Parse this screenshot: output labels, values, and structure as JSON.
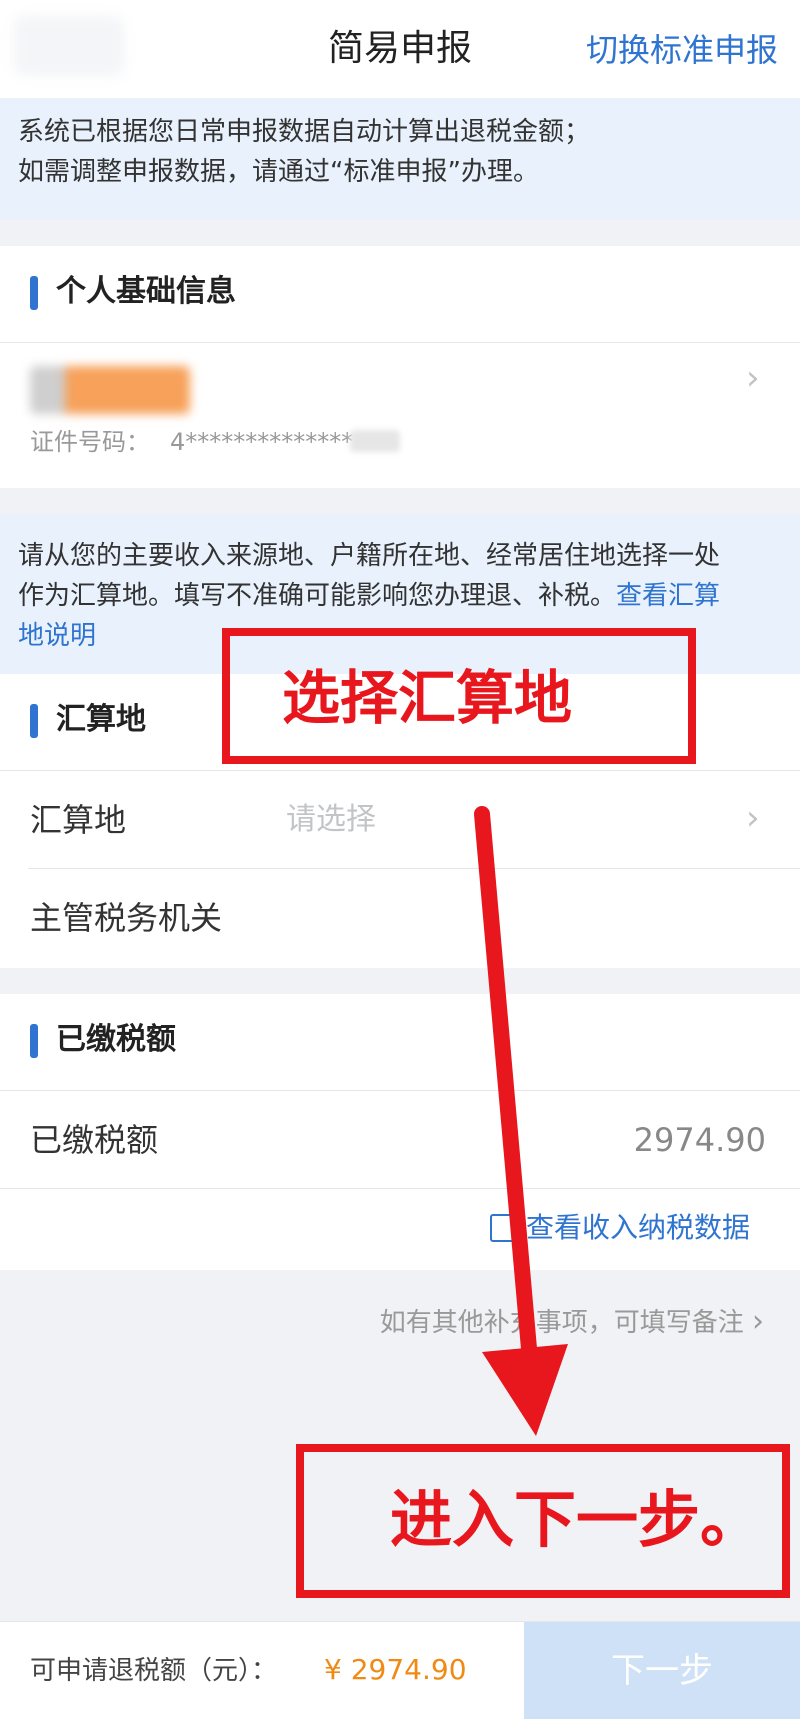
{
  "header": {
    "title": "简易申报",
    "switch_label": "切换标准申报"
  },
  "notice": {
    "line1": "系统已根据您日常申报数据自动计算出退税金额；",
    "line2": "如需调整申报数据，请通过“标准申报”办理。"
  },
  "personal_info": {
    "section_title": "个人基础信息",
    "id_label": "证件号码：",
    "id_value": "4**************"
  },
  "settlement_notice": {
    "line1": "请从您的主要收入来源地、户籍所在地、经常居住地选择一处",
    "line2": "作为汇算地。填写不准确可能影响您办理退、补税。",
    "link_part1": "查看汇算",
    "link_part2": "地说明"
  },
  "settlement": {
    "section_title": "汇算地",
    "place_label": "汇算地",
    "place_placeholder": "请选择",
    "authority_label": "主管税务机关"
  },
  "paid_tax": {
    "section_title": "已缴税额",
    "row_label": "已缴税额",
    "amount": "2974.90",
    "view_data_link": "查看收入纳税数据"
  },
  "remark_link": "如有其他补充事项，可填写备注",
  "annotations": {
    "select_place": "选择汇算地",
    "next_step": "进入下一步。",
    "color": "#e8161d"
  },
  "bottom_bar": {
    "refund_label": "可申请退税额（元）：",
    "refund_value": "¥ 2974.90",
    "next_button": "下一步"
  },
  "colors": {
    "accent": "#2f74d0",
    "notice_bg": "#e9f2fc",
    "refund_amount": "#f08a13",
    "next_button_bg": "#cfe1f7"
  },
  "icons": [
    "chevron-right-icon",
    "document-icon"
  ]
}
